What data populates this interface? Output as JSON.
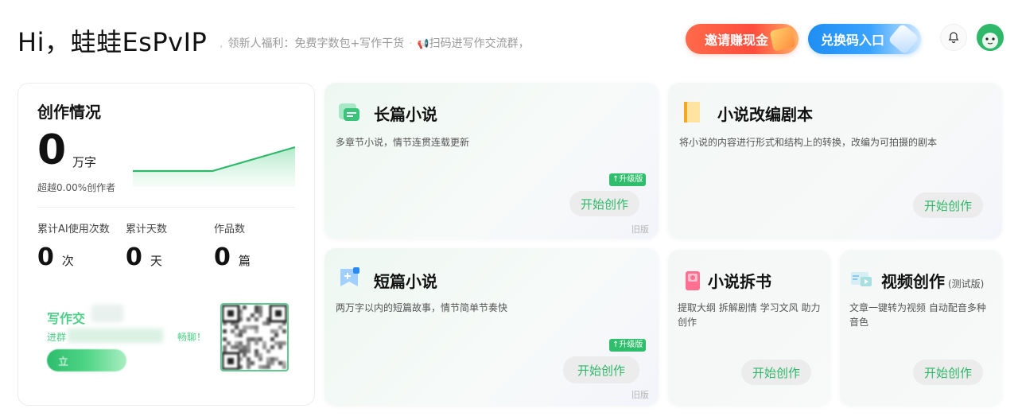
{
  "header": {
    "greeting": "Hi，蛙蛙EsPvIP",
    "notice_1": "领新人福利：免费字数包+写作干货",
    "notice_2": "扫码进写作交流群，",
    "invite_label": "邀请赚现金",
    "redeem_label": "兑换码入口"
  },
  "stats": {
    "title": "创作情况",
    "words": "0",
    "words_unit": "万字",
    "beats": "超越0.00%创作者",
    "sparkline": [
      1,
      1,
      3
    ],
    "metrics": [
      {
        "label": "累计AI使用次数",
        "value": "0",
        "unit": "次"
      },
      {
        "label": "累计天数",
        "value": "0",
        "unit": "天"
      },
      {
        "label": "作品数",
        "value": "0",
        "unit": "篇"
      }
    ],
    "community": {
      "title": "写作交",
      "sub_a": "进群",
      "sub_b": "畅聊！",
      "join": "立"
    }
  },
  "cards": {
    "long_novel": {
      "title": "长篇小说",
      "desc": "多章节小说，情节连贯连载更新",
      "badge": "升级版",
      "start": "开始创作",
      "old": "旧版"
    },
    "adapt": {
      "title": "小说改编剧本",
      "desc": "将小说的内容进行形式和结构上的转换，改编为可拍摄的剧本",
      "start": "开始创作"
    },
    "short_novel": {
      "title": "短篇小说",
      "desc": "两万字以内的短篇故事，情节简单节奏快",
      "badge": "升级版",
      "start": "开始创作",
      "old": "旧版"
    },
    "split_book": {
      "title": "小说拆书",
      "desc": "提取大纲 拆解剧情 学习文风 助力创作",
      "start": "开始创作"
    },
    "video": {
      "title": "视频创作",
      "tag": "(测试版)",
      "desc": "文章一键转为视频 自动配音多种音色",
      "start": "开始创作"
    }
  },
  "colors": {
    "accent": "#2fb86a",
    "invite": "#ff5a3d",
    "redeem": "#2a96f5"
  }
}
